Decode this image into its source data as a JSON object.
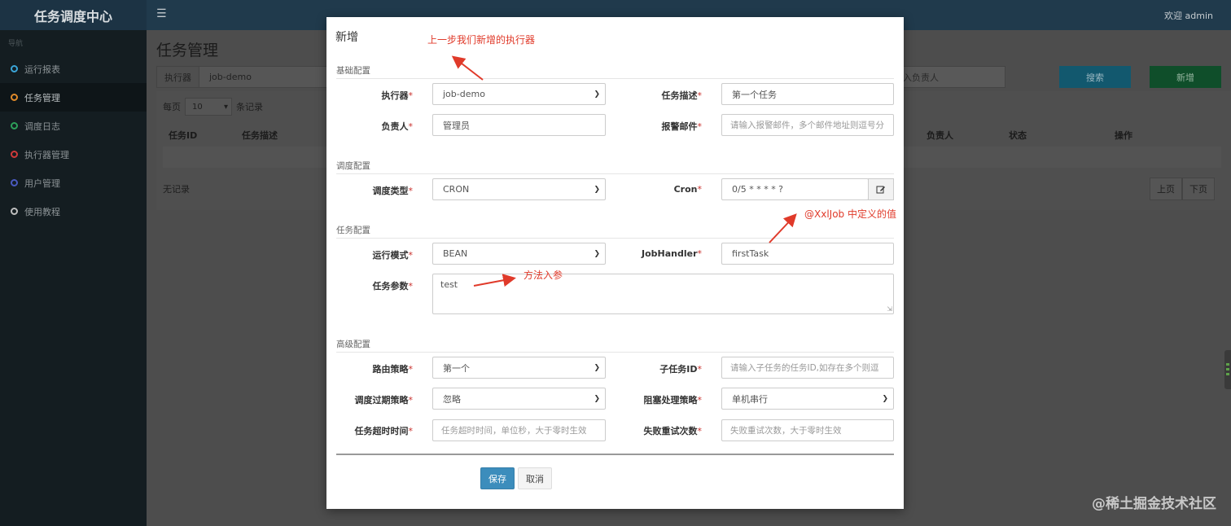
{
  "app": {
    "title": "任务调度中心",
    "menu_icon": "hamburger-icon",
    "welcome": "欢迎 admin"
  },
  "sidebar": {
    "header": "导航",
    "items": [
      {
        "label": "运行报表",
        "color": "#3ba5d8"
      },
      {
        "label": "任务管理",
        "color": "#e08a2a",
        "active": true
      },
      {
        "label": "调度日志",
        "color": "#2da05a"
      },
      {
        "label": "执行器管理",
        "color": "#d03a3a"
      },
      {
        "label": "用户管理",
        "color": "#4a5ac0"
      },
      {
        "label": "使用教程",
        "color": "#bfbfbf"
      }
    ]
  },
  "page": {
    "title": "任务管理",
    "filter": {
      "label": "执行器",
      "value": "job-demo"
    },
    "owner_placeholder": "入负责人",
    "search_label": "搜索",
    "add_label": "新增",
    "per_page_prefix": "每页",
    "per_page_value": "10",
    "per_page_suffix": "条记录",
    "columns": {
      "id": "任务ID",
      "desc": "任务描述",
      "owner": "负责人",
      "status": "状态",
      "ops": "操作"
    },
    "empty": "无记录",
    "prev": "上页",
    "next": "下页"
  },
  "modal": {
    "title": "新增",
    "sections": {
      "basic": "基础配置",
      "schedule": "调度配置",
      "task": "任务配置",
      "advanced": "高级配置"
    },
    "fields": {
      "executor": {
        "label": "执行器",
        "value": "job-demo"
      },
      "job_desc": {
        "label": "任务描述",
        "value": "第一个任务"
      },
      "owner": {
        "label": "负责人",
        "value": "管理员"
      },
      "alarm_email": {
        "label": "报警邮件",
        "placeholder": "请输入报警邮件，多个邮件地址则逗号分"
      },
      "schedule_type": {
        "label": "调度类型",
        "value": "CRON"
      },
      "cron": {
        "label": "Cron",
        "value": "0/5 * * * * ?"
      },
      "run_mode": {
        "label": "运行模式",
        "value": "BEAN"
      },
      "job_handler": {
        "label": "JobHandler",
        "value": "firstTask"
      },
      "job_param": {
        "label": "任务参数",
        "value": "test"
      },
      "route": {
        "label": "路由策略",
        "value": "第一个"
      },
      "child_job": {
        "label": "子任务ID",
        "placeholder": "请输入子任务的任务ID,如存在多个则逗"
      },
      "misfire": {
        "label": "调度过期策略",
        "value": "忽略"
      },
      "block": {
        "label": "阻塞处理策略",
        "value": "单机串行"
      },
      "timeout": {
        "label": "任务超时时间",
        "placeholder": "任务超时时间，单位秒，大于零时生效"
      },
      "retry": {
        "label": "失败重试次数",
        "placeholder": "失败重试次数，大于零时生效"
      }
    },
    "save_label": "保存",
    "cancel_label": "取消"
  },
  "annotations": {
    "executor_note": "上一步我们新增的执行器",
    "handler_note": "@XxlJob 中定义的值",
    "param_note": "方法入参",
    "color": "#e03a2a"
  },
  "watermark": "@稀土掘金技术社区"
}
